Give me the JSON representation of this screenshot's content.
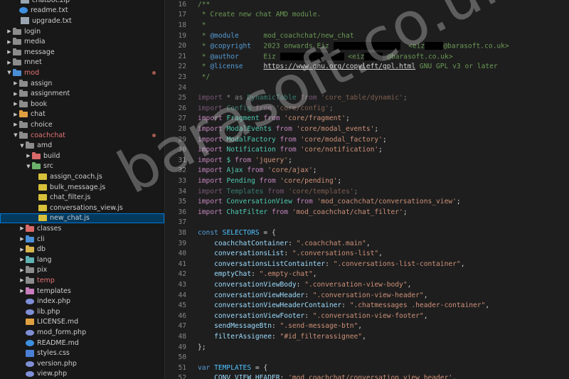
{
  "explorer": {
    "items": [
      {
        "label": "chatbot.zip",
        "depth": 1,
        "kind": "file",
        "icon": "zip-icon",
        "partial": true
      },
      {
        "label": "readme.txt",
        "depth": 1,
        "kind": "file",
        "icon": "info-icon"
      },
      {
        "label": "upgrade.txt",
        "depth": 1,
        "kind": "file",
        "icon": "txt-icon"
      },
      {
        "label": "login",
        "depth": 0,
        "kind": "folder",
        "open": false,
        "color": "gray"
      },
      {
        "label": "media",
        "depth": 0,
        "kind": "folder",
        "open": false,
        "color": "gray"
      },
      {
        "label": "message",
        "depth": 0,
        "kind": "folder",
        "open": false,
        "color": "gray"
      },
      {
        "label": "mnet",
        "depth": 0,
        "kind": "folder",
        "open": false,
        "color": "gray"
      },
      {
        "label": "mod",
        "depth": 0,
        "kind": "folder",
        "open": true,
        "color": "blue",
        "state": "deleted",
        "dot": true
      },
      {
        "label": "assign",
        "depth": 1,
        "kind": "folder",
        "open": false,
        "color": "gray"
      },
      {
        "label": "assignment",
        "depth": 1,
        "kind": "folder",
        "open": false,
        "color": "gray"
      },
      {
        "label": "book",
        "depth": 1,
        "kind": "folder",
        "open": false,
        "color": "gray"
      },
      {
        "label": "chat",
        "depth": 1,
        "kind": "folder",
        "open": false,
        "color": "orange"
      },
      {
        "label": "choice",
        "depth": 1,
        "kind": "folder",
        "open": false,
        "color": "gray"
      },
      {
        "label": "coachchat",
        "depth": 1,
        "kind": "folder",
        "open": true,
        "color": "gray",
        "state": "deleted",
        "dot": true
      },
      {
        "label": "amd",
        "depth": 2,
        "kind": "folder",
        "open": true,
        "color": "gray"
      },
      {
        "label": "build",
        "depth": 3,
        "kind": "folder",
        "open": false,
        "color": "red"
      },
      {
        "label": "src",
        "depth": 3,
        "kind": "folder",
        "open": true,
        "color": "green"
      },
      {
        "label": "assign_coach.js",
        "depth": 4,
        "kind": "file",
        "icon": "js-icon"
      },
      {
        "label": "bulk_message.js",
        "depth": 4,
        "kind": "file",
        "icon": "js-icon"
      },
      {
        "label": "chat_filter.js",
        "depth": 4,
        "kind": "file",
        "icon": "js-icon"
      },
      {
        "label": "conversations_view.js",
        "depth": 4,
        "kind": "file",
        "icon": "js-icon"
      },
      {
        "label": "new_chat.js",
        "depth": 4,
        "kind": "file",
        "icon": "js-icon",
        "selected": true
      },
      {
        "label": "classes",
        "depth": 2,
        "kind": "folder",
        "open": false,
        "color": "red"
      },
      {
        "label": "cli",
        "depth": 2,
        "kind": "folder",
        "open": false,
        "color": "blue"
      },
      {
        "label": "db",
        "depth": 2,
        "kind": "folder",
        "open": false,
        "color": "yellow"
      },
      {
        "label": "lang",
        "depth": 2,
        "kind": "folder",
        "open": false,
        "color": "teal"
      },
      {
        "label": "pix",
        "depth": 2,
        "kind": "folder",
        "open": false,
        "color": "gray"
      },
      {
        "label": "temp",
        "depth": 2,
        "kind": "folder",
        "open": false,
        "color": "gray",
        "state": "deleted"
      },
      {
        "label": "templates",
        "depth": 2,
        "kind": "folder",
        "open": false,
        "color": "pink"
      },
      {
        "label": "index.php",
        "depth": 2,
        "kind": "file",
        "icon": "php-icon"
      },
      {
        "label": "lib.php",
        "depth": 2,
        "kind": "file",
        "icon": "php-icon"
      },
      {
        "label": "LICENSE.md",
        "depth": 2,
        "kind": "file",
        "icon": "license-icon"
      },
      {
        "label": "mod_form.php",
        "depth": 2,
        "kind": "file",
        "icon": "php-icon"
      },
      {
        "label": "README.md",
        "depth": 2,
        "kind": "file",
        "icon": "info-icon"
      },
      {
        "label": "styles.css",
        "depth": 2,
        "kind": "file",
        "icon": "css-icon"
      },
      {
        "label": "version.php",
        "depth": 2,
        "kind": "file",
        "icon": "php-icon"
      },
      {
        "label": "view.php",
        "depth": 2,
        "kind": "file",
        "icon": "php-icon"
      }
    ]
  },
  "editor": {
    "lines": [
      {
        "n": "16",
        "segs": [
          [
            "c-comment",
            "/**"
          ]
        ],
        "partial": true
      },
      {
        "n": "17",
        "segs": [
          [
            "c-comment",
            " * Create new chat AMD module."
          ]
        ]
      },
      {
        "n": "18",
        "segs": [
          [
            "c-comment",
            " *"
          ]
        ]
      },
      {
        "n": "19",
        "segs": [
          [
            "c-comment",
            " * "
          ],
          [
            "c-tag",
            "@module"
          ],
          [
            "c-comment",
            "      mod_coachchat/new_chat"
          ]
        ]
      },
      {
        "n": "20",
        "segs": [
          [
            "c-comment",
            " * "
          ],
          [
            "c-tag",
            "@copyright"
          ],
          [
            "c-comment",
            "   2023 onwards Eiz "
          ],
          [
            "redact",
            "94"
          ],
          [
            "c-comment",
            "  <eiz"
          ],
          [
            "redact",
            "26"
          ],
          [
            "c-comment",
            "@barasoft.co.uk>"
          ]
        ]
      },
      {
        "n": "21",
        "segs": [
          [
            "c-comment",
            " * "
          ],
          [
            "c-tag",
            "@author"
          ],
          [
            "c-comment",
            "      Eiz "
          ],
          [
            "redact",
            "90"
          ],
          [
            "c-comment",
            " <eiz"
          ],
          [
            "redact",
            "26"
          ],
          [
            "c-comment",
            " @barasoft.co.uk>"
          ]
        ]
      },
      {
        "n": "22",
        "segs": [
          [
            "c-comment",
            " * "
          ],
          [
            "c-tag",
            "@license"
          ],
          [
            "c-comment",
            "     "
          ],
          [
            "c-link",
            "https://www.gnu.org/copyleft/gpl.html"
          ],
          [
            "c-comment",
            " GNU GPL v3 or later"
          ]
        ]
      },
      {
        "n": "23",
        "segs": [
          [
            "c-comment",
            " */"
          ]
        ]
      },
      {
        "n": "24",
        "segs": []
      },
      {
        "n": "25",
        "segs": [
          [
            "c-kw dim",
            "import"
          ],
          [
            "dim",
            " * as "
          ],
          [
            "c-cls dim",
            "DynamicTable"
          ],
          [
            "c-kw dim",
            " from "
          ],
          [
            "c-str dim",
            "'core_table/dynamic'"
          ],
          [
            "dim",
            ";"
          ]
        ]
      },
      {
        "n": "26",
        "segs": [
          [
            "c-kw dim",
            "import"
          ],
          [
            "dim",
            " "
          ],
          [
            "c-cls dim",
            "Config"
          ],
          [
            "c-kw dim",
            " from "
          ],
          [
            "c-str dim",
            "'core/config'"
          ],
          [
            "dim",
            ";"
          ]
        ]
      },
      {
        "n": "27",
        "segs": [
          [
            "c-kw",
            "import"
          ],
          [
            "",
            " "
          ],
          [
            "c-cls",
            "Fragment"
          ],
          [
            "c-kw",
            " from "
          ],
          [
            "c-str",
            "'core/fragment'"
          ],
          [
            "",
            ";"
          ]
        ]
      },
      {
        "n": "28",
        "segs": [
          [
            "c-kw",
            "import"
          ],
          [
            "",
            " "
          ],
          [
            "c-cls",
            "ModalEvents"
          ],
          [
            "c-kw",
            " from "
          ],
          [
            "c-str",
            "'core/modal_events'"
          ],
          [
            "",
            ";"
          ]
        ]
      },
      {
        "n": "29",
        "segs": [
          [
            "c-kw",
            "import"
          ],
          [
            "",
            " "
          ],
          [
            "c-cls",
            "ModalFactory"
          ],
          [
            "c-kw",
            " from "
          ],
          [
            "c-str",
            "'core/modal_factory'"
          ],
          [
            "",
            ";"
          ]
        ]
      },
      {
        "n": "30",
        "segs": [
          [
            "c-kw",
            "import"
          ],
          [
            "",
            " "
          ],
          [
            "c-cls",
            "Notification"
          ],
          [
            "c-kw",
            " from "
          ],
          [
            "c-str",
            "'core/notification'"
          ],
          [
            "",
            ";"
          ]
        ]
      },
      {
        "n": "31",
        "segs": [
          [
            "c-kw",
            "import"
          ],
          [
            "",
            " "
          ],
          [
            "c-cls",
            "$"
          ],
          [
            "c-kw",
            " from "
          ],
          [
            "c-str",
            "'jquery'"
          ],
          [
            "",
            ";"
          ]
        ]
      },
      {
        "n": "32",
        "segs": [
          [
            "c-kw",
            "import"
          ],
          [
            "",
            " "
          ],
          [
            "c-cls",
            "Ajax"
          ],
          [
            "c-kw",
            " from "
          ],
          [
            "c-str",
            "'core/ajax'"
          ],
          [
            "",
            ";"
          ]
        ]
      },
      {
        "n": "33",
        "segs": [
          [
            "c-kw",
            "import"
          ],
          [
            "",
            " "
          ],
          [
            "c-cls",
            "Pending"
          ],
          [
            "c-kw",
            " from "
          ],
          [
            "c-str",
            "'core/pending'"
          ],
          [
            "",
            ";"
          ]
        ]
      },
      {
        "n": "34",
        "segs": [
          [
            "c-kw dim",
            "import"
          ],
          [
            "dim",
            " "
          ],
          [
            "c-cls dim",
            "Templates"
          ],
          [
            "c-kw dim",
            " from "
          ],
          [
            "c-str dim",
            "'core/templates'"
          ],
          [
            "dim",
            ";"
          ]
        ]
      },
      {
        "n": "35",
        "segs": [
          [
            "c-kw",
            "import"
          ],
          [
            "",
            " "
          ],
          [
            "c-cls",
            "ConversationView"
          ],
          [
            "c-kw",
            " from "
          ],
          [
            "c-str",
            "'mod_coachchat/conversations_view'"
          ],
          [
            "",
            ";"
          ]
        ]
      },
      {
        "n": "36",
        "segs": [
          [
            "c-kw",
            "import"
          ],
          [
            "",
            " "
          ],
          [
            "c-cls",
            "ChatFilter"
          ],
          [
            "c-kw",
            " from "
          ],
          [
            "c-str",
            "'mod_coachchat/chat_filter'"
          ],
          [
            "",
            ";"
          ]
        ]
      },
      {
        "n": "37",
        "segs": []
      },
      {
        "n": "38",
        "segs": [
          [
            "c-storage",
            "const"
          ],
          [
            "",
            " "
          ],
          [
            "c-var",
            "SELECTORS"
          ],
          [
            "",
            " = {"
          ]
        ]
      },
      {
        "n": "39",
        "segs": [
          [
            "",
            "    "
          ],
          [
            "c-prop",
            "coachchatContainer"
          ],
          [
            "",
            ": "
          ],
          [
            "c-str",
            "\".coachchat.main\""
          ],
          [
            "",
            ","
          ]
        ]
      },
      {
        "n": "40",
        "segs": [
          [
            "",
            "    "
          ],
          [
            "c-prop",
            "conversationsList"
          ],
          [
            "",
            ": "
          ],
          [
            "c-str",
            "\".conversations-list\""
          ],
          [
            "",
            ","
          ]
        ]
      },
      {
        "n": "41",
        "segs": [
          [
            "",
            "    "
          ],
          [
            "c-prop",
            "conversationsListContainter"
          ],
          [
            "",
            ": "
          ],
          [
            "c-str",
            "\".conversations-list-container\""
          ],
          [
            "",
            ","
          ]
        ]
      },
      {
        "n": "42",
        "segs": [
          [
            "",
            "    "
          ],
          [
            "c-prop",
            "emptyChat"
          ],
          [
            "",
            ": "
          ],
          [
            "c-str",
            "\".empty-chat\""
          ],
          [
            "",
            ","
          ]
        ]
      },
      {
        "n": "43",
        "segs": [
          [
            "",
            "    "
          ],
          [
            "c-prop",
            "conversationViewBody"
          ],
          [
            "",
            ": "
          ],
          [
            "c-str",
            "\".conversation-view-body\""
          ],
          [
            "",
            ","
          ]
        ]
      },
      {
        "n": "44",
        "segs": [
          [
            "",
            "    "
          ],
          [
            "c-prop",
            "conversationViewHeader"
          ],
          [
            "",
            ": "
          ],
          [
            "c-str",
            "\".conversation-view-header\""
          ],
          [
            "",
            ","
          ]
        ]
      },
      {
        "n": "45",
        "segs": [
          [
            "",
            "    "
          ],
          [
            "c-prop",
            "conversationViewHeaderContainer"
          ],
          [
            "",
            ": "
          ],
          [
            "c-str",
            "\".chatmessages .header-container\""
          ],
          [
            "",
            ","
          ]
        ]
      },
      {
        "n": "46",
        "segs": [
          [
            "",
            "    "
          ],
          [
            "c-prop",
            "conversationViewFooter"
          ],
          [
            "",
            ": "
          ],
          [
            "c-str",
            "\".conversation-view-footer\""
          ],
          [
            "",
            ","
          ]
        ]
      },
      {
        "n": "47",
        "segs": [
          [
            "",
            "    "
          ],
          [
            "c-prop",
            "sendMessageBtn"
          ],
          [
            "",
            ": "
          ],
          [
            "c-str",
            "\".send-message-btn\""
          ],
          [
            "",
            ","
          ]
        ]
      },
      {
        "n": "48",
        "segs": [
          [
            "",
            "    "
          ],
          [
            "c-prop",
            "filterAssignee"
          ],
          [
            "",
            ": "
          ],
          [
            "c-str",
            "\"#id_filterassignee\""
          ],
          [
            "",
            ","
          ]
        ]
      },
      {
        "n": "49",
        "segs": [
          [
            "",
            "};"
          ]
        ]
      },
      {
        "n": "50",
        "segs": []
      },
      {
        "n": "51",
        "segs": [
          [
            "c-storage",
            "var"
          ],
          [
            "",
            " "
          ],
          [
            "c-var",
            "TEMPLATES"
          ],
          [
            "",
            " = {"
          ]
        ]
      },
      {
        "n": "52",
        "segs": [
          [
            "",
            "    "
          ],
          [
            "c-prop",
            "CONV_VIEW_HEADER"
          ],
          [
            "",
            ": "
          ],
          [
            "c-str",
            "'mod_coachchat/conversation_view_header'"
          ],
          [
            "",
            ","
          ]
        ]
      }
    ]
  },
  "watermark": {
    "text": "barasoft.co.uk"
  }
}
